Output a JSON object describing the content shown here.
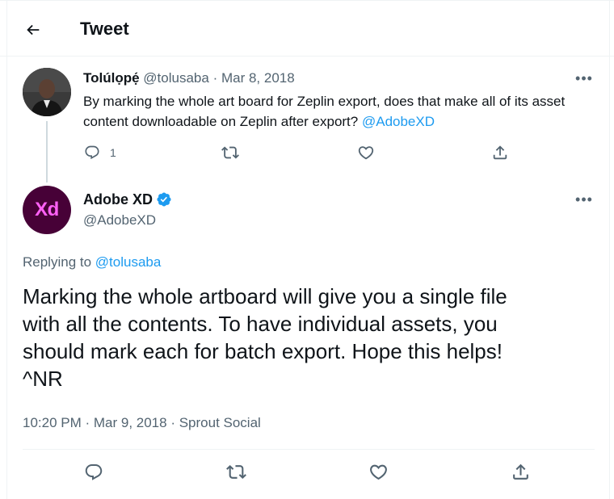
{
  "header": {
    "title": "Tweet"
  },
  "parent": {
    "author_name": "Tolúlọpẹ́",
    "author_handle": "@tolusaba",
    "separator": "·",
    "date": "Mar 8, 2018",
    "text_before": "By marking the whole art board for Zeplin export, does that make all of its asset content downloadable on Zeplin after export? ",
    "mention": "@AdobeXD",
    "reply_count": "1",
    "more": "•••"
  },
  "reply": {
    "author_name": "Adobe XD",
    "author_handle": "@AdobeXD",
    "avatar_text": "Xd",
    "replying_prefix": "Replying to ",
    "replying_to": "@tolusaba",
    "text": "Marking the whole artboard will give you a single file\nwith all the contents. To have individual assets, you\nshould mark each for batch export. Hope this helps!\n^NR",
    "timestamp": "10:20 PM · Mar 9, 2018 · Sprout Social",
    "more": "•••"
  },
  "colors": {
    "accent": "#1d9bf0",
    "text_primary": "#0f1419",
    "text_secondary": "#536471",
    "xd_purple": "#470137",
    "xd_pink": "#ff61f6"
  },
  "icons": {
    "back": "arrow-left-icon",
    "reply": "comment-bubble-icon",
    "retweet": "retweet-icon",
    "like": "heart-icon",
    "share": "share-upload-icon",
    "verified": "verified-badge-icon",
    "more": "more-horizontal-icon"
  }
}
